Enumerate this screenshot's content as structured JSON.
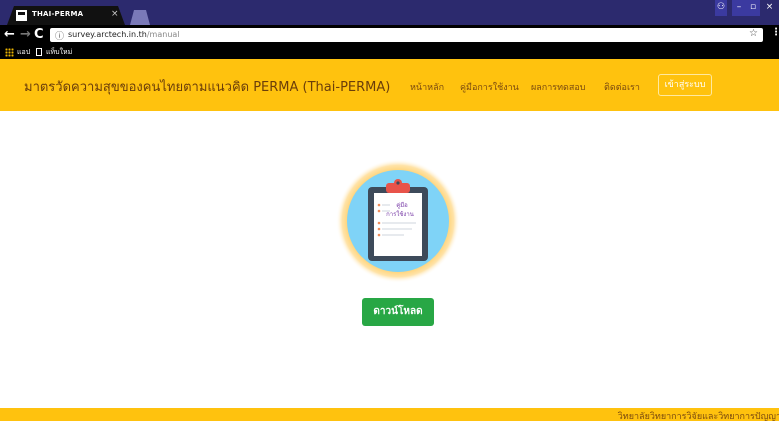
{
  "browser": {
    "tab_title": "THAI-PERMA",
    "tab_close": "×",
    "window_controls": {
      "user": "⚇",
      "minimize": "–",
      "maximize": "▫",
      "close": "×"
    },
    "nav": {
      "back": "←",
      "forward": "→",
      "reload": "C"
    },
    "url_host": "survey.arctech.in.th",
    "url_path": "/manual",
    "info_icon": "ⓘ",
    "star": "☆",
    "menu": "⋮",
    "bookmarks": {
      "apps": "แอป",
      "new_tab": "แท็บใหม่"
    }
  },
  "navbar": {
    "brand": "มาตรวัดความสุขของคนไทยตามแนวคิด PERMA (Thai-PERMA)",
    "links": {
      "home": "หน้าหลัก",
      "manual": "คู่มือการใช้งาน",
      "results": "ผลการทดสอบ",
      "contact": "ติดต่อเรา"
    },
    "login": "เข้าสู่ระบบ"
  },
  "main": {
    "clipboard_line1": "คู่มือ",
    "clipboard_line2": "การใช้งาน",
    "download": "ดาวน์โหลด"
  },
  "footer": {
    "text": "วิทยาลัยวิทยาการวิจัยและวิทยาการปัญญา"
  },
  "colors": {
    "accent": "#ffc20e",
    "button_green": "#28a745",
    "tab_bar": "#2c2a6e"
  }
}
